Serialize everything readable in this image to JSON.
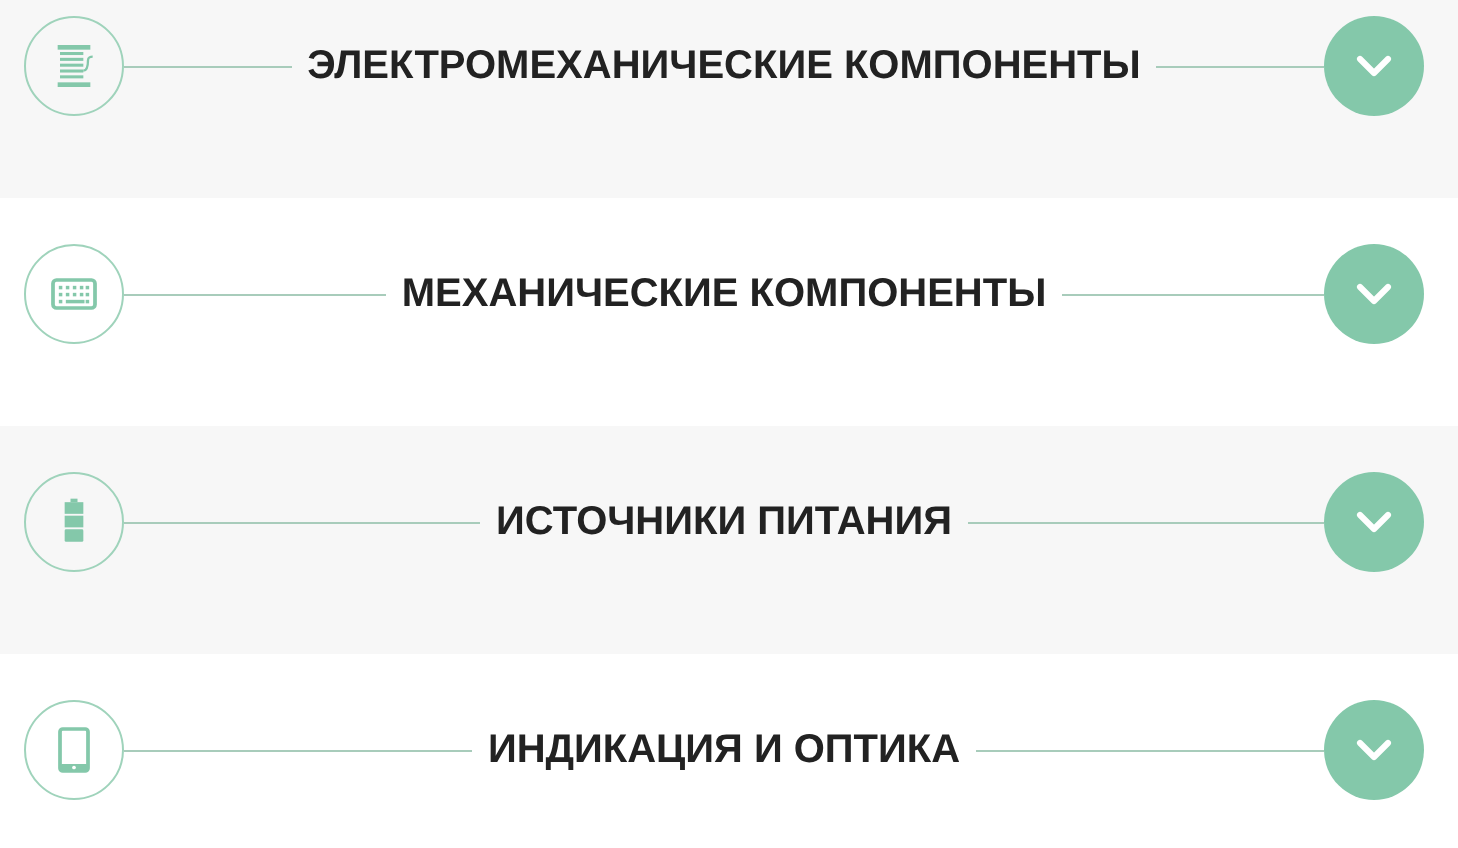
{
  "sections": [
    {
      "title": "ЭЛЕКТРОМЕХАНИЧЕСКИЕ КОМПОНЕНТЫ",
      "expanded": false
    },
    {
      "title": "МЕХАНИЧЕСКИЕ КОМПОНЕНТЫ",
      "expanded": false
    },
    {
      "title": "ИСТОЧНИКИ ПИТАНИЯ",
      "expanded": false
    },
    {
      "title": "ИНДИКАЦИЯ И ОПТИКА",
      "expanded": false
    }
  ]
}
